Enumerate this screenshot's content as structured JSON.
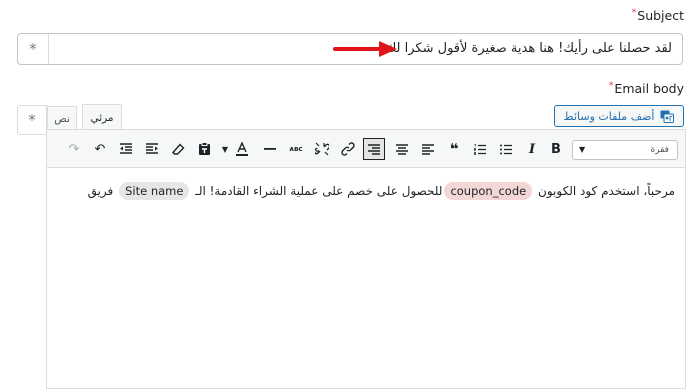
{
  "subject": {
    "label": "Subject",
    "required_mark": "*",
    "value": "لقد حصلنا على رأيك! هنا هدية صغيرة لأقول شكرا لك",
    "asterisk_button": "*"
  },
  "email_body": {
    "label": "Email body",
    "required_mark": "*",
    "asterisk_button": "*",
    "tabs": {
      "text": "نص",
      "visual": "مرئي"
    },
    "add_media_label": "أضف ملفات وسائط",
    "format_select": "فقرة",
    "content": {
      "before_coupon": "مرحباً، استخدم كود الكوبون",
      "coupon_tag": "coupon_code",
      "after_coupon": "للحصول على خصم على عملية الشراء القادمة! الـ",
      "site_tag": "Site name",
      "after_site": "فريق"
    }
  },
  "colors": {
    "accent": "#2271b1",
    "required": "#d63638",
    "arrow": "#e0151a"
  }
}
